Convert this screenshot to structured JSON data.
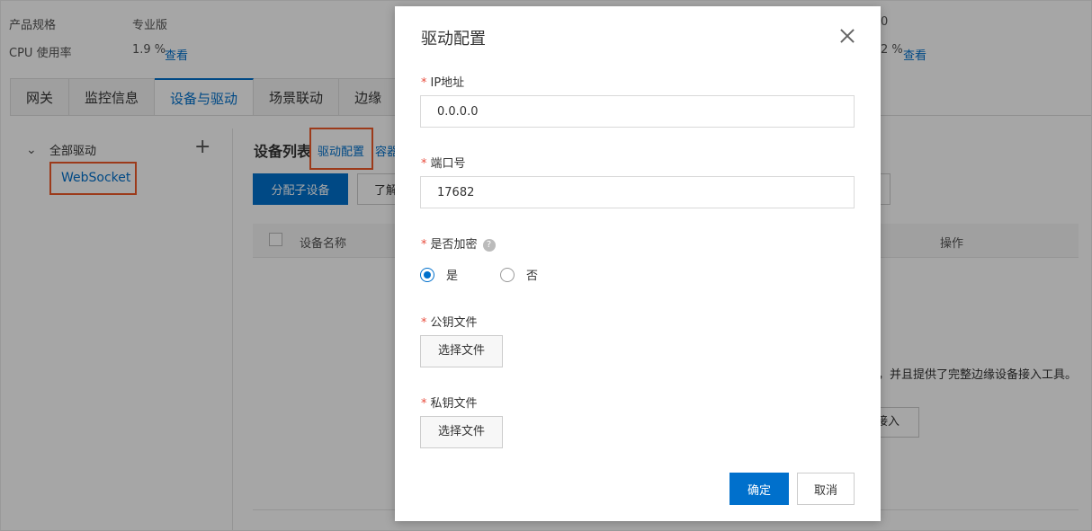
{
  "background": {
    "info": {
      "spec_label": "产品规格",
      "spec_value": "专业版",
      "cpu_label": "CPU 使用率",
      "cpu_value": "1.9 %",
      "view_link": "查看",
      "right_top_value": "0",
      "right_cpu_value": "2 %",
      "right_view_link": "查看"
    },
    "tabs": [
      "网关",
      "监控信息",
      "设备与驱动",
      "场景联动",
      "边缘"
    ],
    "active_tab": 2,
    "tree": {
      "root_label": "全部驱动",
      "add_icon": "+",
      "selected_item": "WebSocket"
    },
    "list": {
      "title": "设备列表",
      "driver_config_link": "驱动配置",
      "container_link": "容器",
      "assign_button": "分配子设备",
      "learn_button": "了解",
      "col_name": "设备名称",
      "col_ops": "操作",
      "empty_text": "，并且提供了完整边缘设备接入工具。",
      "access_button": "接入"
    }
  },
  "dialog": {
    "title": "驱动配置",
    "ip": {
      "label": "IP地址",
      "value": "0.0.0.0"
    },
    "port": {
      "label": "端口号",
      "value": "17682"
    },
    "encrypt": {
      "label": "是否加密",
      "help": "?",
      "options": [
        "是",
        "否"
      ],
      "selected": "是"
    },
    "public_key": {
      "label": "公钥文件",
      "button": "选择文件"
    },
    "private_key": {
      "label": "私钥文件",
      "button": "选择文件"
    },
    "required_mark": "*",
    "ok_button": "确定",
    "cancel_button": "取消"
  },
  "colors": {
    "primary": "#0070cc",
    "highlight": "#f05a28",
    "required": "#e84c3d"
  }
}
